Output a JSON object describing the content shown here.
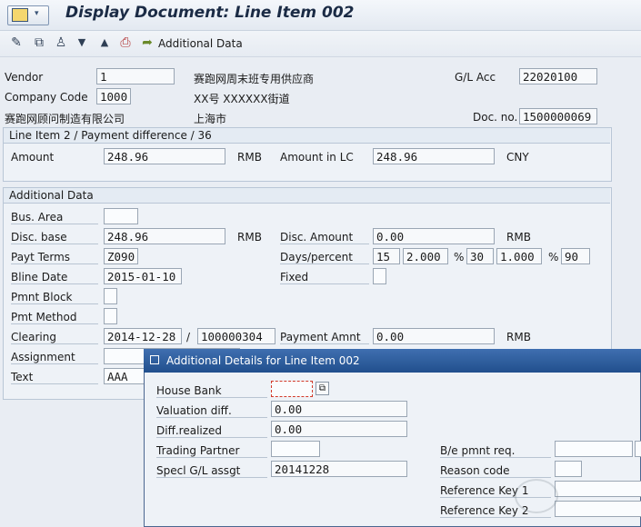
{
  "header": {
    "title": "Display Document: Line Item 002"
  },
  "toolbar": {
    "additional_data_label": "Additional Data"
  },
  "top": {
    "vendor_label": "Vendor",
    "vendor_value": "1",
    "vendor_name": "赛跑网周末班专用供应商",
    "company_code_label": "Company Code",
    "company_code_value": "1000",
    "street": "XX号 XXXXXX街道",
    "company_name": "赛跑网顾问制造有限公司",
    "city": "上海市",
    "gl_acc_label": "G/L Acc",
    "gl_acc_value": "22020100",
    "doc_no_label": "Doc. no.",
    "doc_no_value": "1500000069"
  },
  "line_item": {
    "header": "Line Item 2 / Payment difference / 36",
    "amount_label": "Amount",
    "amount_value": "248.96",
    "amount_currency": "RMB",
    "amount_lc_label": "Amount in LC",
    "amount_lc_value": "248.96",
    "amount_lc_currency": "CNY"
  },
  "additional": {
    "header": "Additional Data",
    "bus_area_label": "Bus. Area",
    "bus_area_value": "",
    "disc_base_label": "Disc. base",
    "disc_base_value": "248.96",
    "disc_base_currency": "RMB",
    "disc_amount_label": "Disc. Amount",
    "disc_amount_value": "0.00",
    "disc_amount_currency": "RMB",
    "payt_terms_label": "Payt Terms",
    "payt_terms_value": "Z090",
    "days_percent_label": "Days/percent",
    "days1": "15",
    "pct1": "2.000",
    "days2": "30",
    "pct2": "1.000",
    "days3": "90",
    "pct_sign": "%",
    "bline_date_label": "Bline Date",
    "bline_date_value": "2015-01-10",
    "fixed_label": "Fixed",
    "pmnt_block_label": "Pmnt Block",
    "pmnt_method_label": "Pmt Method",
    "clearing_label": "Clearing",
    "clearing_date": "2014-12-28",
    "clearing_sep": "/",
    "clearing_doc": "100000304",
    "payment_amnt_label": "Payment Amnt",
    "payment_amnt_value": "0.00",
    "payment_amnt_currency": "RMB",
    "assignment_label": "Assignment",
    "text_label": "Text",
    "text_value": "AAA"
  },
  "dialog": {
    "title": "Additional Details for Line Item 002",
    "house_bank_label": "House Bank",
    "house_bank_value": "",
    "valuation_diff_label": "Valuation diff.",
    "valuation_diff_value": "0.00",
    "diff_realized_label": "Diff.realized",
    "diff_realized_value": "0.00",
    "trading_partner_label": "Trading Partner",
    "trading_partner_value": "",
    "specl_gl_label": "Specl G/L assgt",
    "specl_gl_value": "20141228",
    "be_pmnt_label": "B/e pmnt req.",
    "reason_code_label": "Reason code",
    "ref_key1_label": "Reference Key 1",
    "ref_key2_label": "Reference Key 2"
  }
}
